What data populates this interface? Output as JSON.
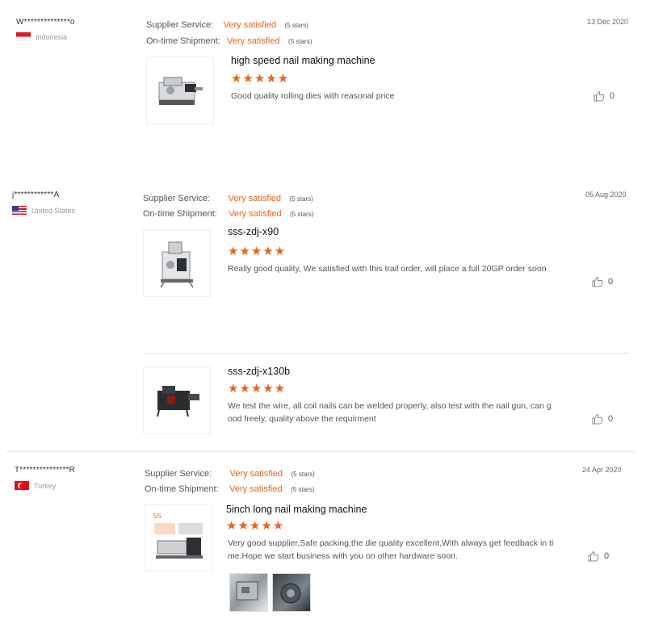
{
  "reviews": [
    {
      "buyer": "W**************o",
      "country": "Indonesia",
      "flag": "indonesia",
      "supplier_label": "Supplier Service:",
      "supplier_value": "Very satisfied",
      "supplier_stars": "(5 stars)",
      "shipment_label": "On-time Shipment:",
      "shipment_value": "Very satisfied",
      "shipment_stars": "(5 stars)",
      "date": "13 Dec 2020",
      "items": [
        {
          "title": "high speed nail making machine",
          "rating": 5,
          "stars": "★★★★★",
          "comment": "Good quality rolling dies with reasonal price",
          "likes": "0"
        }
      ]
    },
    {
      "buyer": "j************A",
      "country": "United States",
      "flag": "usa",
      "supplier_label": "Supplier Service:",
      "supplier_value": "Very satisfied",
      "supplier_stars": "(5 stars)",
      "shipment_label": "On-time Shipment:",
      "shipment_value": "Very satisfied",
      "shipment_stars": "(5 stars)",
      "date": "05 Aug 2020",
      "items": [
        {
          "title": "sss-zdj-x90",
          "rating": 5,
          "stars": "★★★★★",
          "comment": "Really good quality, We satisfied with this trail order, will place a full 20GP order soon",
          "likes": "0"
        },
        {
          "title": "sss-zdj-x130b",
          "rating": 5,
          "stars": "★★★★★",
          "comment": "We test the wire, all coil nails can be welded properly, also test with the nail gun, can good freely, quality above the requirment",
          "likes": "0"
        }
      ]
    },
    {
      "buyer": "T***************R",
      "country": "Turkey",
      "flag": "turkey",
      "supplier_label": "Supplier Service:",
      "supplier_value": "Very satisfied",
      "supplier_stars": "(5 stars)",
      "shipment_label": "On-time Shipment:",
      "shipment_value": "Very satisfied",
      "shipment_stars": "(5 stars)",
      "date": "24 Apr 2020",
      "items": [
        {
          "title": "5inch long nail making machine",
          "rating": 5,
          "stars": "★★★★★",
          "comment": "Very good supplier,Safe packing,the die quality excellent,With always get feedback in time.Hope we start business with you on other hardware soon.",
          "likes": "0"
        }
      ]
    }
  ],
  "colors": {
    "accent": "#e8641b",
    "divider": "#e4e4e4"
  },
  "icons": {
    "like": "thumbs-up-icon"
  }
}
